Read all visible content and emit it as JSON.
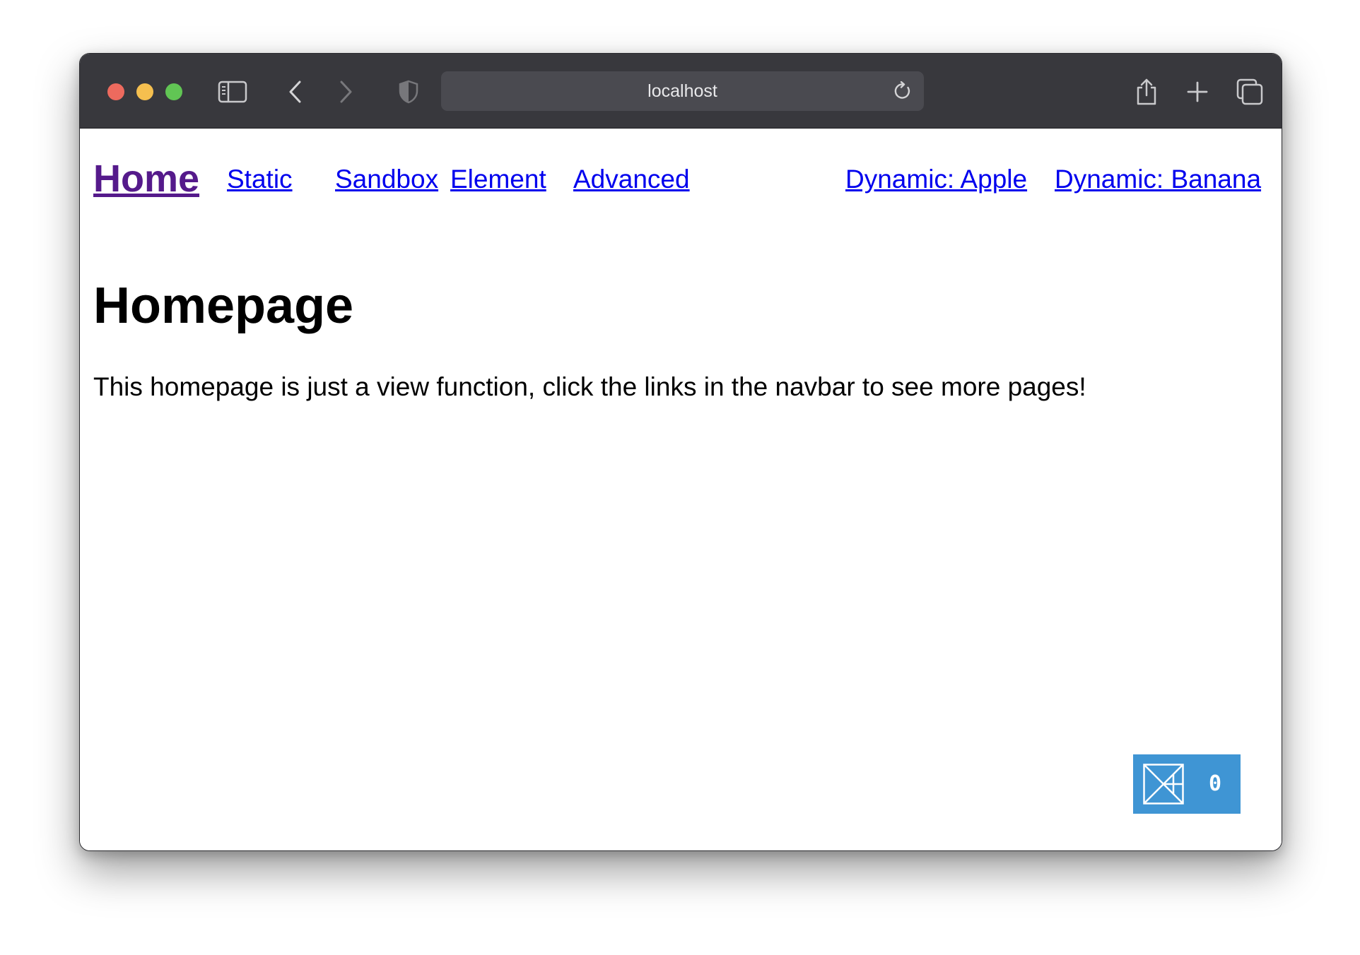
{
  "browser": {
    "url": "localhost"
  },
  "icons": {
    "close": "close-button",
    "minimize": "minimize-button",
    "maximize": "maximize-button",
    "sidebar": "sidebar-icon",
    "back": "chevron-left-icon",
    "forward": "chevron-right-icon",
    "privacy": "shield-icon",
    "reload": "reload-icon",
    "share": "share-icon",
    "new_tab": "plus-icon",
    "tabs": "tab-overview-icon",
    "widget": "tangram-logo-icon"
  },
  "colors": {
    "toolbar": "#38383d",
    "link": "#0000ee",
    "visited_link": "#551a8b",
    "widget_bg": "#3f95d4"
  },
  "nav": {
    "home": "Home",
    "static": "Static",
    "sandbox": "Sandbox",
    "element": "Element",
    "advanced": "Advanced",
    "dynamic_apple": "Dynamic: Apple",
    "dynamic_banana": "Dynamic: Banana"
  },
  "page": {
    "title": "Homepage",
    "text": "This homepage is just a view function, click the links in the navbar to see more pages!"
  },
  "widget": {
    "count": "0"
  }
}
